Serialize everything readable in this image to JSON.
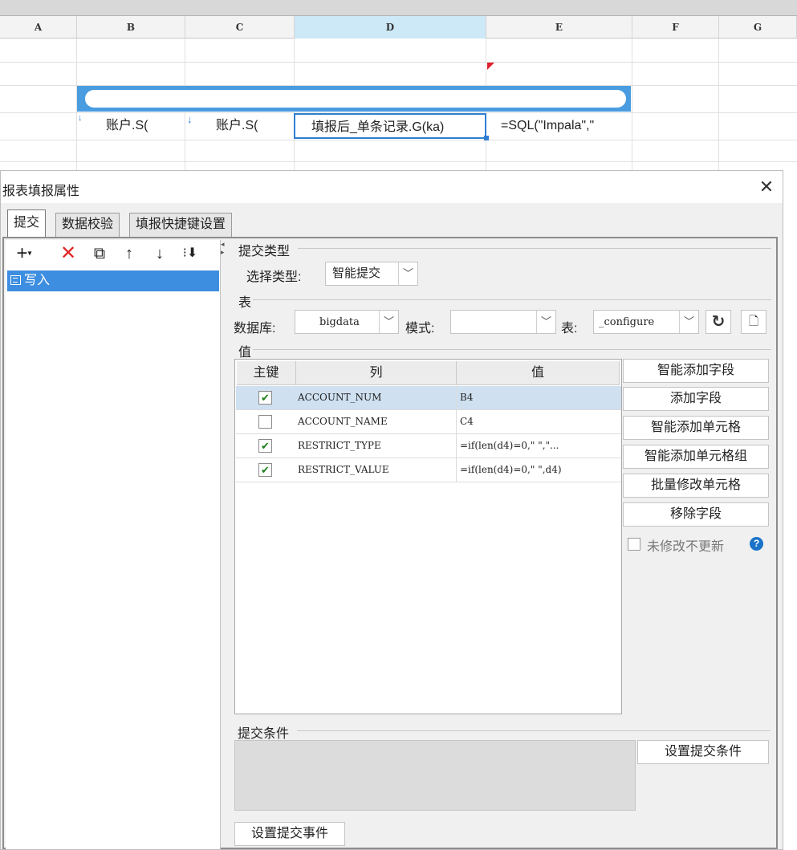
{
  "sheet": {
    "columns": [
      "A",
      "B",
      "C",
      "D",
      "E",
      "F",
      "G"
    ],
    "cells": {
      "b4": "账户.S(",
      "c4": "账户.S(",
      "d4": "填报后_单条记录.G(ka)",
      "e4": "=SQL(\"Impala\",\""
    }
  },
  "dialog": {
    "title": "报表填报属性",
    "close_icon": "close-icon",
    "tabs": [
      "提交",
      "数据校验",
      "填报快捷键设置"
    ],
    "active_tab": "提交",
    "toolbar": [
      "add-icon",
      "delete-icon",
      "copy-icon",
      "up-arrow-icon",
      "down-arrow-icon",
      "move-bottom-icon"
    ],
    "list_items": [
      "写入"
    ],
    "submit_type_group": "提交类型",
    "select_type_label": "选择类型:",
    "select_type_value": "智能提交",
    "table_group": "表",
    "database_label": "数据库:",
    "database_value": "bigdata",
    "schema_label": "模式:",
    "schema_value": "",
    "table_label": "表:",
    "table_value": "_configure",
    "values_group": "值",
    "table_headers": [
      "主键",
      "列",
      "值"
    ],
    "rows": [
      {
        "key": true,
        "column": "ACCOUNT_NUM",
        "value": "B4"
      },
      {
        "key": false,
        "column": "ACCOUNT_NAME",
        "value": "C4"
      },
      {
        "key": true,
        "column": "RESTRICT_TYPE",
        "value": "=if(len(d4)=0,\" \",\"..."
      },
      {
        "key": true,
        "column": "RESTRICT_VALUE",
        "value": "=if(len(d4)=0,\" \",d4)"
      }
    ],
    "buttons": [
      "智能添加字段",
      "添加字段",
      "智能添加单元格",
      "智能添加单元格组",
      "批量修改单元格",
      "移除字段"
    ],
    "no_update_label": "未修改不更新",
    "condition_group": "提交条件",
    "set_condition_button": "设置提交条件",
    "set_event_button": "设置提交事件",
    "colors": {
      "accent": "#3d8ee0",
      "selected_row": "#cfe0f0",
      "delete_red": "#e02626",
      "check_green": "#1a7f1a"
    }
  }
}
